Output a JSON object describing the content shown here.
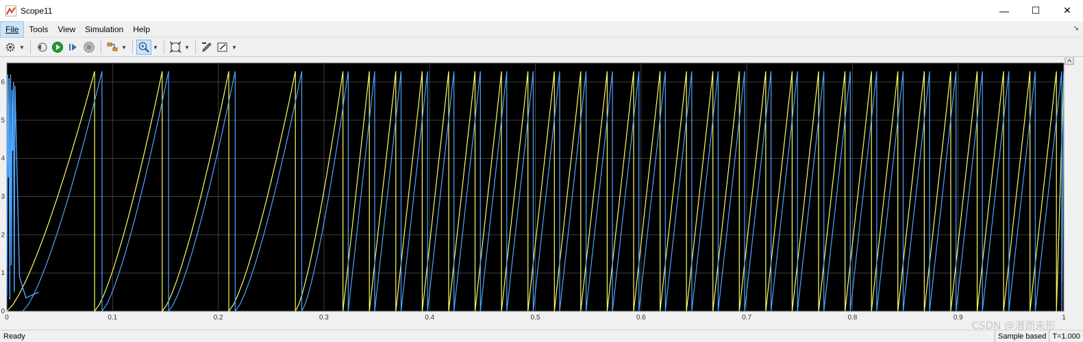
{
  "window": {
    "title": "Scope11",
    "minimize_glyph": "—",
    "maximize_glyph": "☐",
    "close_glyph": "✕"
  },
  "menu": {
    "items": [
      {
        "label": "File"
      },
      {
        "label": "Tools"
      },
      {
        "label": "View"
      },
      {
        "label": "Simulation"
      },
      {
        "label": "Help"
      }
    ],
    "pin_glyph": "↘"
  },
  "toolbar": {
    "buttons": [
      "settings-icon",
      "restore-icon",
      "run-icon",
      "step-forward-icon",
      "stop-icon",
      "signal-selection-icon",
      "zoom-in-icon",
      "fit-to-view-icon",
      "edit-style-icon",
      "measurement-icon"
    ]
  },
  "status": {
    "ready": "Ready",
    "mode": "Sample based",
    "time": "T=1.000"
  },
  "watermark": "CSDN @潜而未形",
  "colors": {
    "plot_bg": "#000000",
    "grid": "#404040",
    "series1": "#ffff66",
    "series2": "#4fa6ff"
  },
  "chart_data": {
    "type": "line",
    "xlim": [
      0,
      1
    ],
    "ylim": [
      0,
      6.5
    ],
    "x_ticks": [
      "0",
      "0.1",
      "0.2",
      "0.3",
      "0.4",
      "0.5",
      "0.6",
      "0.7",
      "0.8",
      "0.9",
      "1"
    ],
    "y_ticks": [
      "0",
      "1",
      "2",
      "3",
      "4",
      "5",
      "6"
    ],
    "grid": true,
    "series": [
      {
        "color": "#ffff66",
        "description": "sawtooth wrapping 0 to 2π",
        "reset_times": [
          0.0,
          0.083,
          0.147,
          0.21,
          0.273,
          0.318,
          0.343,
          0.368,
          0.393,
          0.418,
          0.443,
          0.468,
          0.493,
          0.518,
          0.543,
          0.568,
          0.593,
          0.618,
          0.643,
          0.668,
          0.693,
          0.718,
          0.743,
          0.768,
          0.793,
          0.818,
          0.843,
          0.868,
          0.893,
          0.918,
          0.943,
          0.968,
          0.993
        ]
      },
      {
        "color": "#4fa6ff",
        "description": "sawtooth wrapping 0 to 2π, lagging",
        "reset_times": [
          0.015,
          0.09,
          0.153,
          0.216,
          0.279,
          0.323,
          0.348,
          0.373,
          0.398,
          0.423,
          0.448,
          0.473,
          0.498,
          0.523,
          0.548,
          0.573,
          0.598,
          0.623,
          0.648,
          0.673,
          0.698,
          0.723,
          0.748,
          0.773,
          0.798,
          0.823,
          0.848,
          0.873,
          0.898,
          0.923,
          0.948,
          0.973,
          0.998
        ],
        "peak": 6.28
      }
    ]
  }
}
